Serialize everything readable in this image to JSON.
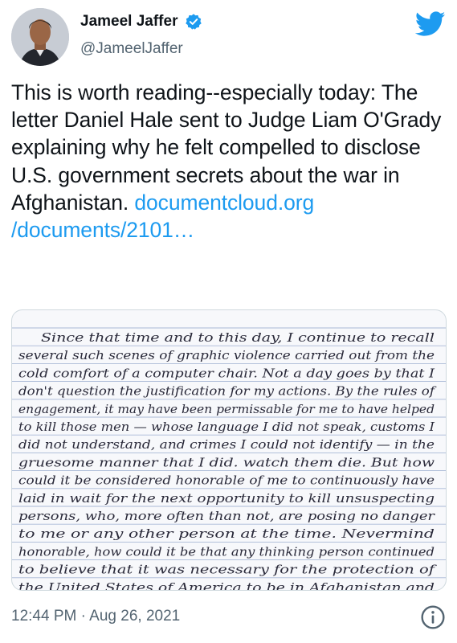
{
  "author": {
    "name": "Jameel Jaffer",
    "handle": "@JameelJaffer"
  },
  "tweet": {
    "text": "This is worth reading--especially today: The letter Daniel Hale sent to Judge Liam O'Grady explaining why he felt compelled to disclose U.S. government secrets about the war in Afghanistan.",
    "link_line1": "documentcloud.org",
    "link_line2": "/documents/2101…"
  },
  "letter_lines": [
    "Since that time and to this day, I continue to recall",
    "several such scenes of graphic violence carried out from the",
    "cold comfort of a computer chair. Not a day goes by that I",
    "don't question the justification for my actions. By the rules of",
    "engagement, it may have been permissable for me to have helped",
    "to kill those men — whose language I did not speak, customs I",
    "did not understand, and crimes I could not identify — in the",
    "gruesome manner that I did. watch them die. But how",
    "could it be considered honorable of me to continuously have",
    "laid in wait for the next opportunity to kill unsuspecting",
    "persons, who, more often than not, are posing no danger",
    "to me or any other person at the time. Nevermind",
    "honorable, how could it be that any thinking person continued",
    "to believe that it was necessary for the protection of",
    "the United States of America to be in Afghanistan and"
  ],
  "footer": {
    "timestamp": "12:44 PM · Aug 26, 2021"
  },
  "colors": {
    "brand_blue": "#1d9bf0",
    "text": "#0f1419",
    "secondary": "#536471",
    "paper_line": "#a9b8d6",
    "ink": "#2a2a3a"
  },
  "icons": {
    "verified": "verified-badge-icon",
    "logo": "twitter-bird-icon",
    "info": "info-icon"
  }
}
